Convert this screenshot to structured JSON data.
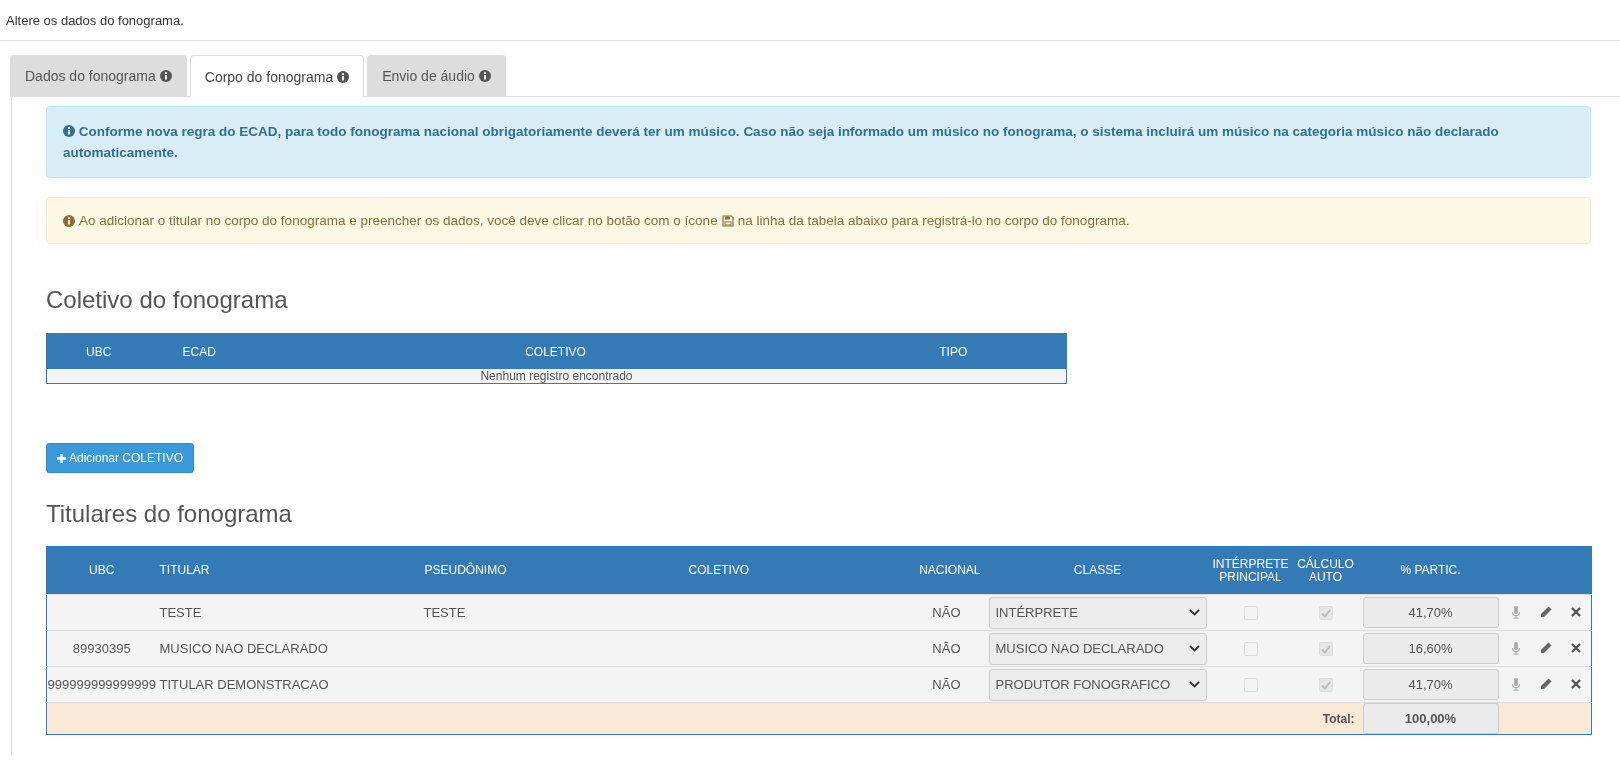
{
  "page_title": "Altere os dados do fonograma.",
  "tabs": [
    {
      "label": "Dados do fonograma",
      "selected": false
    },
    {
      "label": "Corpo do fonograma",
      "selected": true
    },
    {
      "label": "Envio de áudio",
      "selected": false
    }
  ],
  "info_alert": {
    "text": "Conforme nova regra do ECAD, para todo fonograma nacional obrigatoriamente deverá ter um músico. Caso não seja informado um músico no fonograma, o sistema incluirá um músico na categoria músico não declarado automaticamente."
  },
  "warning_alert": {
    "text_before_icon": "Ao adicionar o titular no corpo do fonograma e preencher os dados, você deve clicar no botão com o ícone",
    "text_after_icon": "na linha da tabela abaixo para registrá-lo no corpo do fonograma."
  },
  "coletivo_section": {
    "heading": "Coletivo do fonograma",
    "columns": [
      "UBC",
      "ECAD",
      "COLETIVO",
      "TIPO"
    ],
    "empty_message": "Nenhum registro encontrado",
    "add_button": "Adicionar COLETIVO"
  },
  "titulares_section": {
    "heading": "Titulares do fonograma",
    "columns": [
      "UBC",
      "TITULAR",
      "PSEUDÔNIMO",
      "COLETIVO",
      "NACIONAL",
      "CLASSE",
      "INTÉRPRETE PRINCIPAL",
      "CÁLCULO AUTO",
      "% PARTIC."
    ],
    "rows": [
      {
        "ubc": "",
        "titular": "TESTE",
        "pseudonimo": "TESTE",
        "coletivo": "",
        "nacional": "NÃO",
        "classe": "INTÉRPRETE",
        "interprete_principal": false,
        "calculo_auto": true,
        "partic": "41,70%"
      },
      {
        "ubc": "89930395",
        "titular": "MUSICO NAO DECLARADO",
        "pseudonimo": "",
        "coletivo": "",
        "nacional": "NÃO",
        "classe": "MUSICO NAO DECLARADO",
        "interprete_principal": false,
        "calculo_auto": true,
        "partic": "16,60%"
      },
      {
        "ubc": "999999999999999",
        "titular": "TITULAR DEMONSTRACAO",
        "pseudonimo": "",
        "coletivo": "",
        "nacional": "NÃO",
        "classe": "PRODUTOR FONOGRAFICO",
        "interprete_principal": false,
        "calculo_auto": true,
        "partic": "41,70%"
      }
    ],
    "total_label": "Total:",
    "total_value": "100,00%"
  }
}
